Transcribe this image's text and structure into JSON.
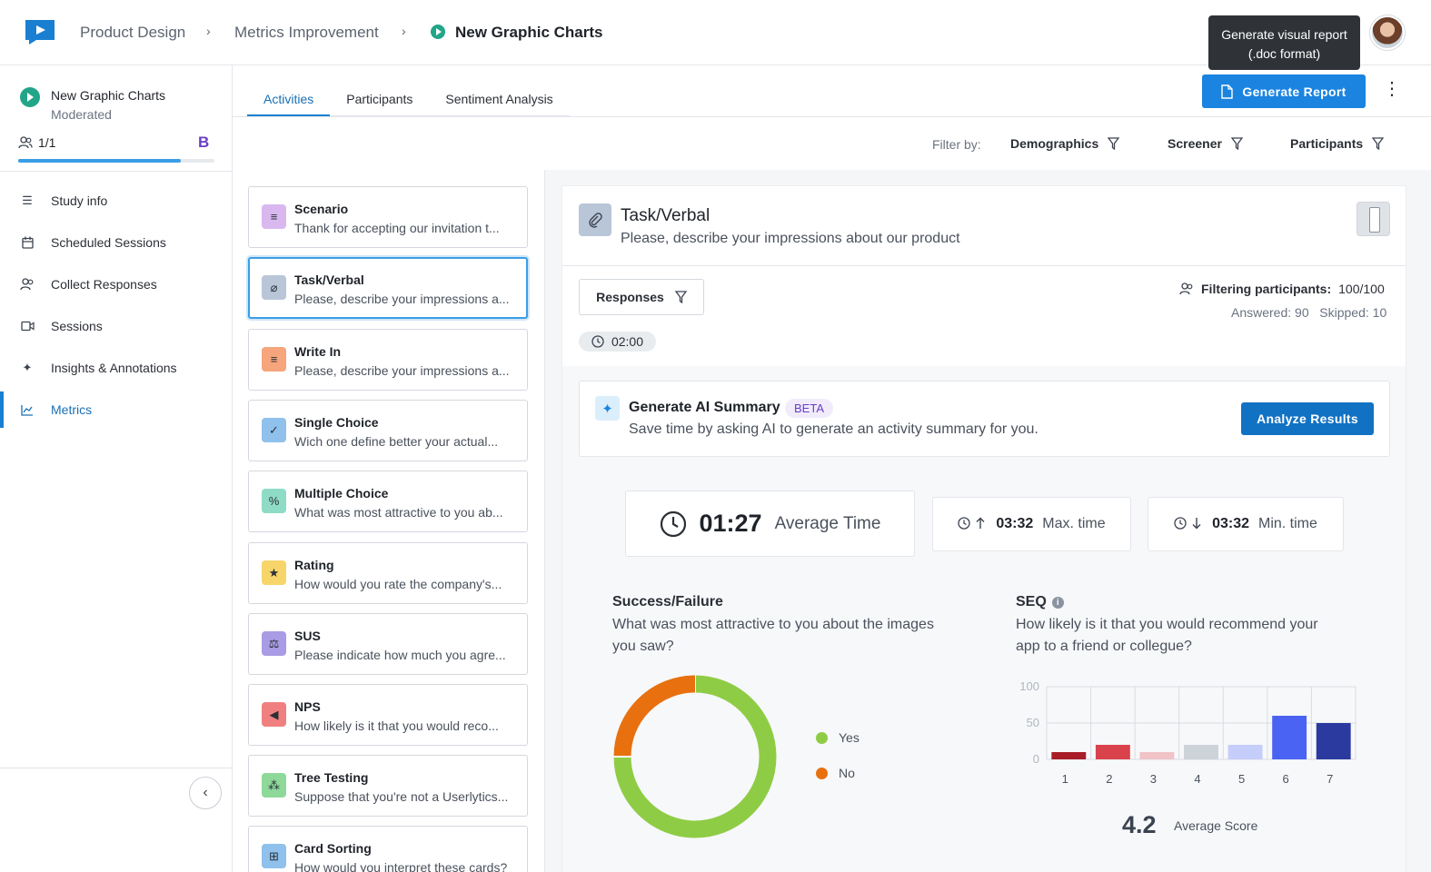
{
  "header": {
    "breadcrumbs": [
      "Product Design",
      "Metrics Improvement",
      "New Graphic Charts"
    ],
    "tooltip_line1": "Generate visual report",
    "tooltip_line2": "(.doc format)"
  },
  "sidebar": {
    "study_title": "New Graphic Charts",
    "study_subtitle": "Moderated",
    "participants": "1/1",
    "badge": "B",
    "progress_fraction": 0.83,
    "items": [
      {
        "label": "Study info",
        "icon": "list-icon"
      },
      {
        "label": "Scheduled Sessions",
        "icon": "calendar-icon"
      },
      {
        "label": "Collect Responses",
        "icon": "users-icon"
      },
      {
        "label": "Sessions",
        "icon": "video-icon"
      },
      {
        "label": "Insights & Annotations",
        "icon": "sparkle-icon"
      },
      {
        "label": "Metrics",
        "icon": "chart-icon"
      }
    ]
  },
  "tabs": [
    "Activities",
    "Participants",
    "Sentiment Analysis"
  ],
  "generate_report_label": "Generate Report",
  "filters": {
    "label": "Filter by:",
    "items": [
      "Demographics",
      "Screener",
      "Participants"
    ]
  },
  "activities": [
    {
      "title": "Scenario",
      "desc": "Thank for accepting our invitation t...",
      "icon": "text-icon",
      "color": "#d9b8f0"
    },
    {
      "title": "Task/Verbal",
      "desc": "Please, describe your impressions a...",
      "icon": "paperclip-icon",
      "color": "#b9c6d8"
    },
    {
      "title": "Write In",
      "desc": "Please, describe your impressions a...",
      "icon": "text-icon",
      "color": "#f6a57c"
    },
    {
      "title": "Single Choice",
      "desc": "Wich one define better your actual...",
      "icon": "check-icon",
      "color": "#8fc1ec"
    },
    {
      "title": "Multiple Choice",
      "desc": "What was most attractive to you ab...",
      "icon": "percent-icon",
      "color": "#8fdcc6"
    },
    {
      "title": "Rating",
      "desc": "How would you rate the company's...",
      "icon": "star-icon",
      "color": "#f7d56b"
    },
    {
      "title": "SUS",
      "desc": "Please indicate how much you agre...",
      "icon": "scale-icon",
      "color": "#a99ce4"
    },
    {
      "title": "NPS",
      "desc": "How likely is it that you would reco...",
      "icon": "megaphone-icon",
      "color": "#f08080"
    },
    {
      "title": "Tree Testing",
      "desc": "Suppose that you're not a Userlytics...",
      "icon": "tree-icon",
      "color": "#8ed99a"
    },
    {
      "title": "Card Sorting",
      "desc": "How would you interpret these cards?",
      "icon": "grid-icon",
      "color": "#8fc1ec"
    }
  ],
  "task": {
    "title": "Task/Verbal",
    "desc": "Please, describe your impressions about our product"
  },
  "responses_label": "Responses",
  "timer": "02:00",
  "filtering": {
    "label": "Filtering participants:",
    "value": "100/100",
    "answered": "Answered: 90",
    "skipped": "Skipped: 10"
  },
  "ai": {
    "title": "Generate AI Summary",
    "beta": "BETA",
    "desc": "Save time by asking AI to generate an activity summary for you.",
    "button": "Analyze Results"
  },
  "stats": {
    "avg_time": "01:27",
    "avg_label": "Average Time",
    "max_time": "03:32",
    "max_label": "Max. time",
    "min_time": "03:32",
    "min_label": "Min. time"
  },
  "success_chart": {
    "title": "Success/Failure",
    "question": "What was most attractive to you about the images you saw?"
  },
  "seq_chart": {
    "title": "SEQ",
    "question": "How likely is it that you would recommend your app to a friend or collegue?",
    "avg_score": "4.2",
    "avg_label": "Average Score"
  },
  "chart_data": [
    {
      "type": "pie",
      "title": "Success/Failure",
      "categories": [
        "Yes",
        "No"
      ],
      "values": [
        75,
        25
      ],
      "colors": [
        "#8fcc45",
        "#e8700f"
      ],
      "legend": "right"
    },
    {
      "type": "bar",
      "title": "SEQ",
      "categories": [
        "1",
        "2",
        "3",
        "4",
        "5",
        "6",
        "7"
      ],
      "values": [
        10,
        20,
        10,
        20,
        20,
        60,
        50
      ],
      "colors": [
        "#a81d28",
        "#d9414b",
        "#f1c3c6",
        "#ccd3d9",
        "#c5cdfa",
        "#4a63f2",
        "#2a3a9e"
      ],
      "ylim": [
        0,
        100
      ],
      "yticks": [
        0,
        50,
        100
      ],
      "grid": true
    }
  ]
}
